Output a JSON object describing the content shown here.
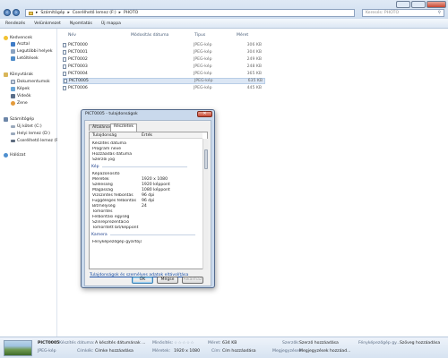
{
  "address": {
    "segments": [
      "Számítógép",
      "Cserélhető lemez (F:)",
      "PHOTO"
    ],
    "separator": "▸",
    "search_placeholder": "Keresés: PHOTO"
  },
  "toolbar": {
    "organize": "Rendezés",
    "share": "Velünkmezet",
    "print": "Nyomtatás",
    "new_folder": "Új mappa"
  },
  "sidebar": {
    "favorites_header": "Kedvencek",
    "favorites": [
      "Asztal",
      "Legutóbbi helyek",
      "Letöltések"
    ],
    "libraries_header": "Könyvtárak",
    "libraries": [
      "Dokumentumok",
      "Képek",
      "Videók",
      "Zene"
    ],
    "computer_header": "Számítógép",
    "computer": [
      "Új kötet (C:)",
      "Helyi lemez (D:)",
      "Cserélhető lemez (F:)"
    ],
    "network": "Hálózat"
  },
  "list": {
    "columns": {
      "name": "Név",
      "date": "Módosítás dátuma",
      "type": "Típus",
      "size": "Méret"
    },
    "files": [
      {
        "name": "PICT0000",
        "type": "JPEG-kép",
        "size": "306 KB"
      },
      {
        "name": "PICT0001",
        "type": "JPEG-kép",
        "size": "304 KB"
      },
      {
        "name": "PICT0002",
        "type": "JPEG-kép",
        "size": "249 KB"
      },
      {
        "name": "PICT0003",
        "type": "JPEG-kép",
        "size": "248 KB"
      },
      {
        "name": "PICT0004",
        "type": "JPEG-kép",
        "size": "365 KB"
      },
      {
        "name": "PICT0005",
        "type": "JPEG-kép",
        "size": "635 KB"
      },
      {
        "name": "PICT0006",
        "type": "JPEG-kép",
        "size": "445 KB"
      }
    ],
    "selected_index": 5
  },
  "dialog": {
    "title": "PICT0005 - tulajdonságok",
    "tabs": [
      "Általános",
      "Részletek"
    ],
    "active_tab": 1,
    "header_name": "Tulajdonság",
    "header_value": "Érték",
    "rows_top": [
      {
        "name": "Készítés dátuma",
        "value": ""
      },
      {
        "name": "Program neve",
        "value": ""
      },
      {
        "name": "Hozzáadás dátuma",
        "value": ""
      },
      {
        "name": "Szerzői jog",
        "value": ""
      }
    ],
    "section_image": "Kép",
    "rows_image": [
      {
        "name": "Képazonosító",
        "value": ""
      },
      {
        "name": "Méretek",
        "value": "1920 x 1080"
      },
      {
        "name": "Szélesség",
        "value": "1920 képpont"
      },
      {
        "name": "Magasság",
        "value": "1080 képpont"
      },
      {
        "name": "Vízszintes felbontás",
        "value": "96 dpi"
      },
      {
        "name": "Függőleges felbontás",
        "value": "96 dpi"
      },
      {
        "name": "Bitmélység",
        "value": "24"
      },
      {
        "name": "Tömörítés",
        "value": ""
      },
      {
        "name": "Felbontási egység",
        "value": ""
      },
      {
        "name": "Színreprezentáció",
        "value": ""
      },
      {
        "name": "Tömörített bit/képpont",
        "value": ""
      }
    ],
    "section_camera": "Kamera",
    "rows_camera": [
      {
        "name": "Fényképezőgép gyártója",
        "value": ""
      }
    ],
    "remove_link": "Tulajdonságok és személyes adatok eltávolítása",
    "ok": "OK",
    "cancel": "Mégse",
    "apply": "Alkalmaz"
  },
  "details": {
    "filename": "PICT0005",
    "filetype": "JPEG-kép",
    "fields": [
      {
        "label": "Készítés dátuma:",
        "value": "A készítés dátumának ..."
      },
      {
        "label": "Címkék:",
        "value": "Címke hozzáadása"
      },
      {
        "label": "Minősítés:",
        "value": "☆☆☆☆☆"
      },
      {
        "label": "Méretek:",
        "value": "1920 x 1080"
      },
      {
        "label": "Méret:",
        "value": "634 KB"
      },
      {
        "label": "Cím:",
        "value": "Cím hozzáadása"
      },
      {
        "label": "Szerzők:",
        "value": "Szerző hozzáadása"
      },
      {
        "label": "Megjegyzések:",
        "value": "Megjegyzések hozzáad..."
      },
      {
        "label": "Fényképezőgép gy...",
        "value": "Szöveg hozzáadása"
      }
    ]
  }
}
